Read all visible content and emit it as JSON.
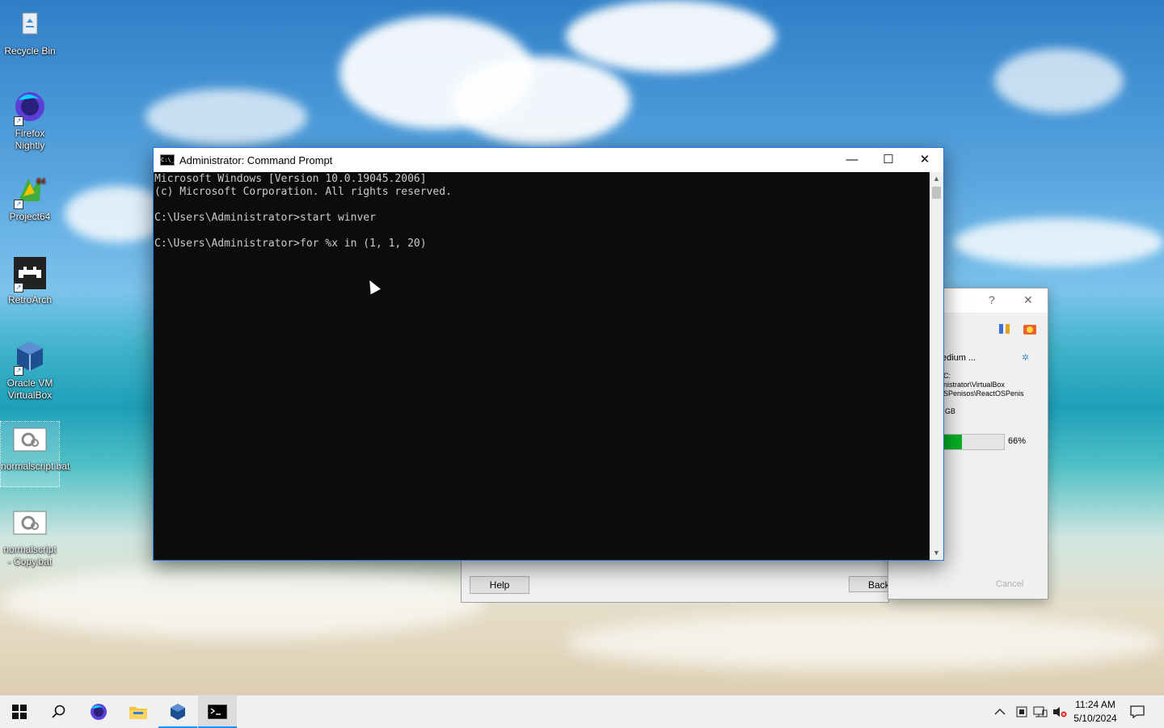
{
  "desktop": {
    "icons": [
      {
        "label": "Recycle Bin"
      },
      {
        "label": "Firefox Nightly"
      },
      {
        "label": "Project64"
      },
      {
        "label": "RetroArch"
      },
      {
        "label": "Oracle VM VirtualBox"
      },
      {
        "label": "normalscript.bat"
      },
      {
        "label": "normalscript - Copy.bat"
      }
    ]
  },
  "cmd": {
    "title": "Administrator: Command Prompt",
    "icon_text": "C:\\_",
    "lines": [
      "Microsoft Windows [Version 10.0.19045.2006]",
      "(c) Microsoft Corporation. All rights reserved.",
      "",
      "C:\\Users\\Administrator>start winver",
      "",
      "C:\\Users\\Administrator>for %x in (1, 1, 20)"
    ],
    "minimize": "—",
    "maximize": "☐",
    "close": "✕"
  },
  "vbox": {
    "help_label": "Help",
    "back_label": "Back",
    "cancel_label": "Cancel",
    "question": "?",
    "close": "✕",
    "medium_label": "edium ...",
    "path_lines": [
      "C:",
      "nistrator\\VirtualBox",
      "SPenisos\\ReactOSPenis"
    ],
    "size_text": "GB",
    "progress_text": "66%",
    "progress_value": 0.66
  },
  "taskbar": {
    "time": "11:24 AM",
    "date": "5/10/2024"
  }
}
